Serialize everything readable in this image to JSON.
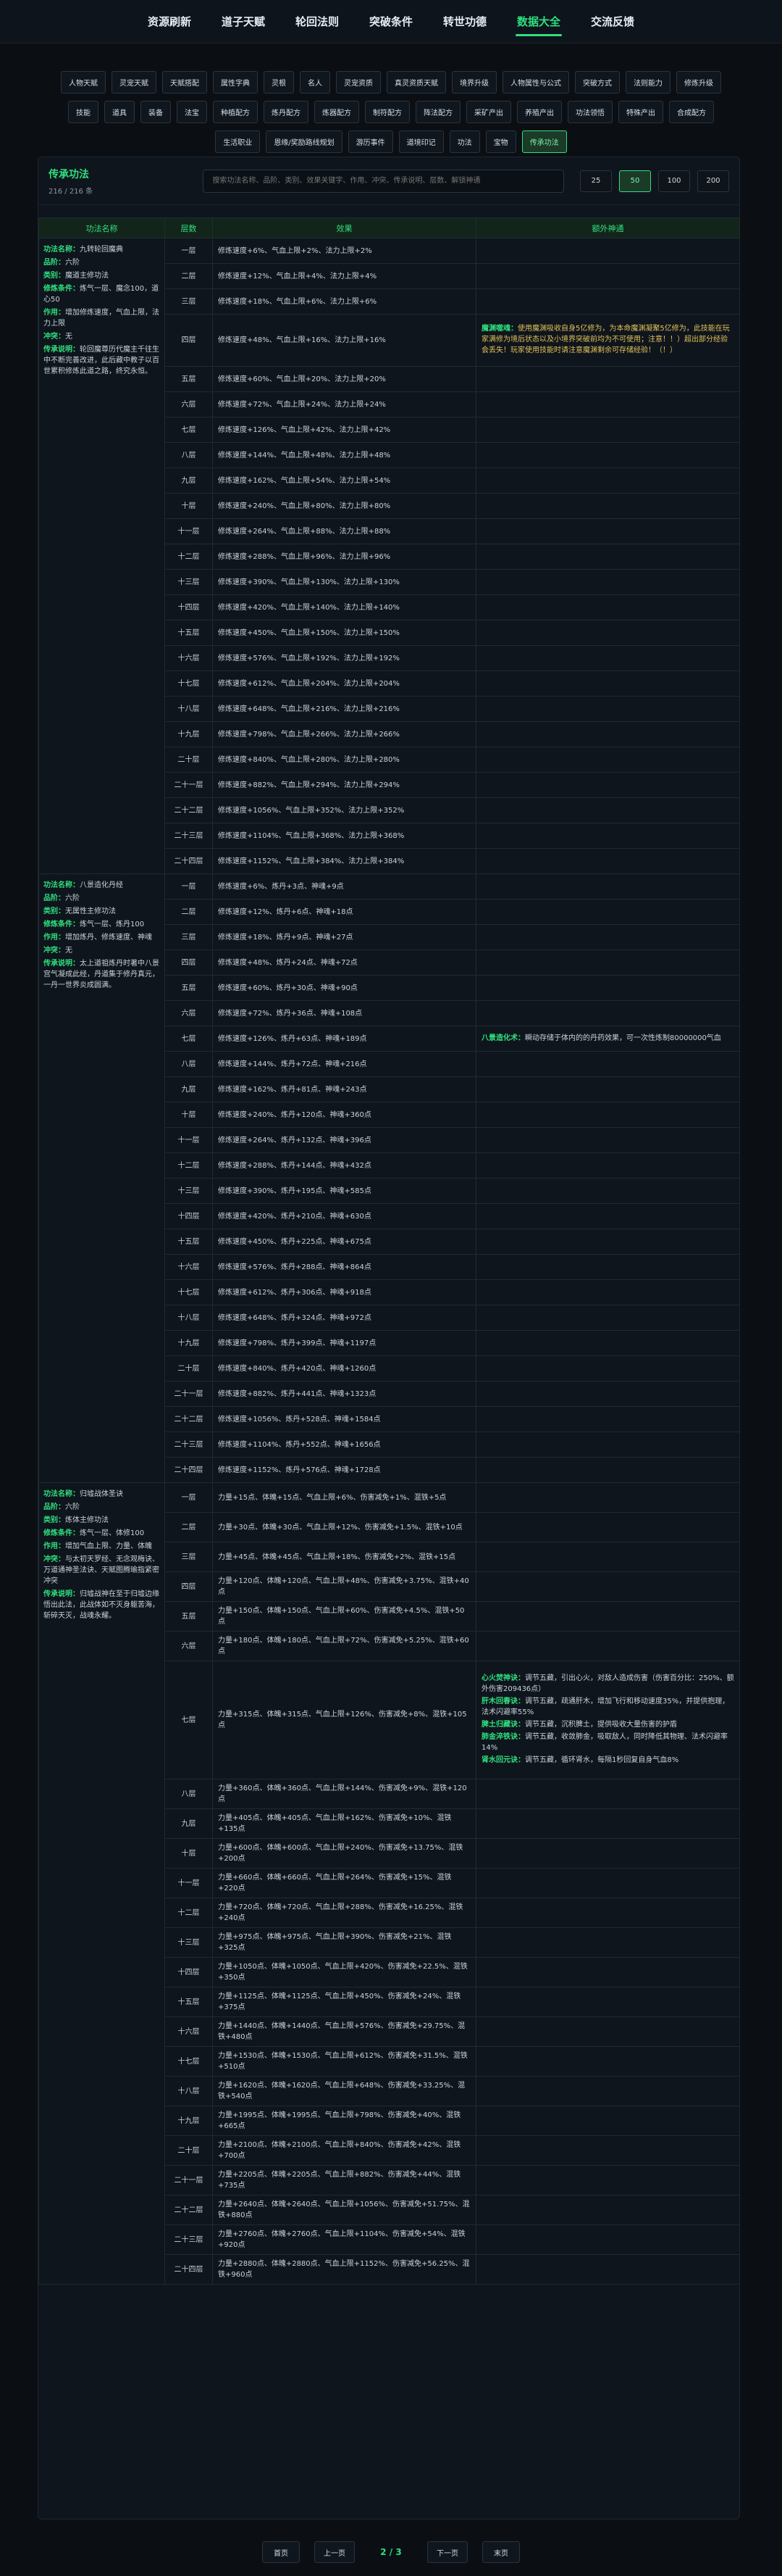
{
  "nav": [
    "资源刷新",
    "道子天赋",
    "轮回法则",
    "突破条件",
    "转世功德",
    "数据大全",
    "交流反馈"
  ],
  "nav_active": 5,
  "subtabs": [
    "人物天赋",
    "灵宠天赋",
    "天赋搭配",
    "属性字典",
    "灵根",
    "名人",
    "灵宠资质",
    "真灵资质天赋",
    "境界升级",
    "人物属性与公式",
    "突破方式",
    "法则能力",
    "修炼升级",
    "技能",
    "道具",
    "装备",
    "法宝",
    "种植配方",
    "炼丹配方",
    "炼器配方",
    "制符配方",
    "阵法配方",
    "采矿产出",
    "养殖产出",
    "功法领悟",
    "特殊产出",
    "合成配方",
    "生活职业",
    "恩缘/奖励路线规划",
    "游历事件",
    "道境印记",
    "功法",
    "宝物",
    "传承功法"
  ],
  "subtab_active": 33,
  "panel": {
    "title": "传承功法",
    "count": "216 / 216 条",
    "search_placeholder": "搜索功法名称、品阶、类别、效果关键字、作用、冲突、传承说明、层数、解锁神通",
    "page_sizes": [
      "25",
      "50",
      "100",
      "200"
    ],
    "page_size_active": 1
  },
  "table": {
    "headers": [
      "功法名称",
      "层数",
      "效果",
      "额外神通"
    ],
    "groups": [
      {
        "info": [
          {
            "k": "功法名称：",
            "v": "九转轮回魔典"
          },
          {
            "k": "品阶：",
            "v": "六阶"
          },
          {
            "k": "类别：",
            "v": "魔道主修功法"
          },
          {
            "k": "修炼条件：",
            "v": "炼气一层、魔念100，道心50"
          },
          {
            "k": "作用：",
            "v": "增加修炼速度，气血上限，法力上限"
          },
          {
            "k": "冲突：",
            "v": "无"
          },
          {
            "k": "传承说明：",
            "v": "轮回魔尊历代魔主千往生中不断完善改进，此后藏中教子以百世累积修炼此道之路，终究永恒。"
          }
        ],
        "rows": [
          {
            "layer": "一层",
            "effect": "修炼速度+6%、气血上限+2%、法力上限+2%"
          },
          {
            "layer": "二层",
            "effect": "修炼速度+12%、气血上限+4%、法力上限+4%"
          },
          {
            "layer": "三层",
            "effect": "修炼速度+18%、气血上限+6%、法力上限+6%"
          },
          {
            "layer": "四层",
            "effect": "修炼速度+48%、气血上限+16%、法力上限+16%",
            "bonus": [
              {
                "k": "魔渊噬魂：",
                "v": "使用魔渊吸收自身5亿修为，为本命魔渊凝聚5亿修为，此技能在玩家满修为境后状态以及小境界突破前均为不可使用；注意！！）超出部分经验会丢失！玩家使用技能时请注意魔渊剩余可存储经验！（！）",
                "c": "yl"
              }
            ]
          },
          {
            "layer": "五层",
            "effect": "修炼速度+60%、气血上限+20%、法力上限+20%"
          },
          {
            "layer": "六层",
            "effect": "修炼速度+72%、气血上限+24%、法力上限+24%"
          },
          {
            "layer": "七层",
            "effect": "修炼速度+126%、气血上限+42%、法力上限+42%"
          },
          {
            "layer": "八层",
            "effect": "修炼速度+144%、气血上限+48%、法力上限+48%"
          },
          {
            "layer": "九层",
            "effect": "修炼速度+162%、气血上限+54%、法力上限+54%"
          },
          {
            "layer": "十层",
            "effect": "修炼速度+240%、气血上限+80%、法力上限+80%"
          },
          {
            "layer": "十一层",
            "effect": "修炼速度+264%、气血上限+88%、法力上限+88%"
          },
          {
            "layer": "十二层",
            "effect": "修炼速度+288%、气血上限+96%、法力上限+96%"
          },
          {
            "layer": "十三层",
            "effect": "修炼速度+390%、气血上限+130%、法力上限+130%"
          },
          {
            "layer": "十四层",
            "effect": "修炼速度+420%、气血上限+140%、法力上限+140%"
          },
          {
            "layer": "十五层",
            "effect": "修炼速度+450%、气血上限+150%、法力上限+150%"
          },
          {
            "layer": "十六层",
            "effect": "修炼速度+576%、气血上限+192%、法力上限+192%"
          },
          {
            "layer": "十七层",
            "effect": "修炼速度+612%、气血上限+204%、法力上限+204%"
          },
          {
            "layer": "十八层",
            "effect": "修炼速度+648%、气血上限+216%、法力上限+216%"
          },
          {
            "layer": "十九层",
            "effect": "修炼速度+798%、气血上限+266%、法力上限+266%"
          },
          {
            "layer": "二十层",
            "effect": "修炼速度+840%、气血上限+280%、法力上限+280%"
          },
          {
            "layer": "二十一层",
            "effect": "修炼速度+882%、气血上限+294%、法力上限+294%"
          },
          {
            "layer": "二十二层",
            "effect": "修炼速度+1056%、气血上限+352%、法力上限+352%"
          },
          {
            "layer": "二十三层",
            "effect": "修炼速度+1104%、气血上限+368%、法力上限+368%"
          },
          {
            "layer": "二十四层",
            "effect": "修炼速度+1152%、气血上限+384%、法力上限+384%"
          }
        ]
      },
      {
        "info": [
          {
            "k": "功法名称：",
            "v": "八景造化丹经"
          },
          {
            "k": "品阶：",
            "v": "六阶"
          },
          {
            "k": "类别：",
            "v": "无属性主修功法"
          },
          {
            "k": "修炼条件：",
            "v": "炼气一层、炼丹100"
          },
          {
            "k": "作用：",
            "v": "增加炼丹、修炼速度、神魂"
          },
          {
            "k": "冲突：",
            "v": "无"
          },
          {
            "k": "传承说明：",
            "v": "太上道祖炼丹时著中八景宫气凝成此经，丹道集于修丹真元，一丹一世界炎成圆满。"
          }
        ],
        "rows": [
          {
            "layer": "一层",
            "effect": "修炼速度+6%、炼丹+3点、神魂+9点"
          },
          {
            "layer": "二层",
            "effect": "修炼速度+12%、炼丹+6点、神魂+18点"
          },
          {
            "layer": "三层",
            "effect": "修炼速度+18%、炼丹+9点、神魂+27点"
          },
          {
            "layer": "四层",
            "effect": "修炼速度+48%、炼丹+24点、神魂+72点"
          },
          {
            "layer": "五层",
            "effect": "修炼速度+60%、炼丹+30点、神魂+90点"
          },
          {
            "layer": "六层",
            "effect": "修炼速度+72%、炼丹+36点、神魂+108点"
          },
          {
            "layer": "七层",
            "effect": "修炼速度+126%、炼丹+63点、神魂+189点",
            "bonus": [
              {
                "k": "八景造化术：",
                "v": "瞬动存储于体内的的丹药效果，可一次性炼制80000000气血"
              }
            ]
          },
          {
            "layer": "八层",
            "effect": "修炼速度+144%、炼丹+72点、神魂+216点"
          },
          {
            "layer": "九层",
            "effect": "修炼速度+162%、炼丹+81点、神魂+243点"
          },
          {
            "layer": "十层",
            "effect": "修炼速度+240%、炼丹+120点、神魂+360点"
          },
          {
            "layer": "十一层",
            "effect": "修炼速度+264%、炼丹+132点、神魂+396点"
          },
          {
            "layer": "十二层",
            "effect": "修炼速度+288%、炼丹+144点、神魂+432点"
          },
          {
            "layer": "十三层",
            "effect": "修炼速度+390%、炼丹+195点、神魂+585点"
          },
          {
            "layer": "十四层",
            "effect": "修炼速度+420%、炼丹+210点、神魂+630点"
          },
          {
            "layer": "十五层",
            "effect": "修炼速度+450%、炼丹+225点、神魂+675点"
          },
          {
            "layer": "十六层",
            "effect": "修炼速度+576%、炼丹+288点、神魂+864点"
          },
          {
            "layer": "十七层",
            "effect": "修炼速度+612%、炼丹+306点、神魂+918点"
          },
          {
            "layer": "十八层",
            "effect": "修炼速度+648%、炼丹+324点、神魂+972点"
          },
          {
            "layer": "十九层",
            "effect": "修炼速度+798%、炼丹+399点、神魂+1197点"
          },
          {
            "layer": "二十层",
            "effect": "修炼速度+840%、炼丹+420点、神魂+1260点"
          },
          {
            "layer": "二十一层",
            "effect": "修炼速度+882%、炼丹+441点、神魂+1323点"
          },
          {
            "layer": "二十二层",
            "effect": "修炼速度+1056%、炼丹+528点、神魂+1584点"
          },
          {
            "layer": "二十三层",
            "effect": "修炼速度+1104%、炼丹+552点、神魂+1656点"
          },
          {
            "layer": "二十四层",
            "effect": "修炼速度+1152%、炼丹+576点、神魂+1728点"
          }
        ]
      },
      {
        "info": [
          {
            "k": "功法名称：",
            "v": "归墟战体圣诀"
          },
          {
            "k": "品阶：",
            "v": "六阶"
          },
          {
            "k": "类别：",
            "v": "炼体主修功法"
          },
          {
            "k": "修炼条件：",
            "v": "炼气一层、体修100"
          },
          {
            "k": "作用：",
            "v": "增加气血上限、力量、体魄"
          },
          {
            "k": "冲突：",
            "v": "与太初天罗经、无念观梅诀、万道通神圣法诀、天赋图腾瑜指紧密冲突"
          },
          {
            "k": "传承说明：",
            "v": "归墟战神在至于归墟边缘悟出此法，此战体如不灭身躯苦海，斩碎天灭，战魂永耀。"
          }
        ],
        "rows": [
          {
            "layer": "一层",
            "effect": "力量+15点、体魄+15点、气血上限+6%、伤害减免+1%、混铁+5点"
          },
          {
            "layer": "二层",
            "effect": "力量+30点、体魄+30点、气血上限+12%、伤害减免+1.5%、混铁+10点"
          },
          {
            "layer": "三层",
            "effect": "力量+45点、体魄+45点、气血上限+18%、伤害减免+2%、混铁+15点"
          },
          {
            "layer": "四层",
            "effect": "力量+120点、体魄+120点、气血上限+48%、伤害减免+3.75%、混铁+40点"
          },
          {
            "layer": "五层",
            "effect": "力量+150点、体魄+150点、气血上限+60%、伤害减免+4.5%、混铁+50点"
          },
          {
            "layer": "六层",
            "effect": "力量+180点、体魄+180点、气血上限+72%、伤害减免+5.25%、混铁+60点"
          },
          {
            "layer": "七层",
            "effect": "力量+315点、体魄+315点、气血上限+126%、伤害减免+8%、混铁+105点",
            "bonus": [
              {
                "k": "心火焚神诀：",
                "v": "调节五藏，引出心火，对敌人造成伤害（伤害百分比：250%、额外伤害209436点）"
              },
              {
                "k": "肝木回春诀：",
                "v": "调节五藏，疏通肝木，增加飞行和移动速度35%，并提供抱理，法术闪避率55%"
              },
              {
                "k": "脾土归藏诀：",
                "v": "调节五藏，沉积脾土，提供吸收大量伤害的护盾"
              },
              {
                "k": "肺金淬铁诀：",
                "v": "调节五藏，收敛肺金，吸取敌人，同时降低其物理、法术闪避率14%"
              },
              {
                "k": "肾水回元诀：",
                "v": "调节五藏，循环肾水，每隔1秒回复自身气血8%"
              }
            ]
          },
          {
            "layer": "八层",
            "effect": "力量+360点、体魄+360点、气血上限+144%、伤害减免+9%、混铁+120点"
          },
          {
            "layer": "九层",
            "effect": "力量+405点、体魄+405点、气血上限+162%、伤害减免+10%、混铁+135点"
          },
          {
            "layer": "十层",
            "effect": "力量+600点、体魄+600点、气血上限+240%、伤害减免+13.75%、混铁+200点"
          },
          {
            "layer": "十一层",
            "effect": "力量+660点、体魄+660点、气血上限+264%、伤害减免+15%、混铁+220点"
          },
          {
            "layer": "十二层",
            "effect": "力量+720点、体魄+720点、气血上限+288%、伤害减免+16.25%、混铁+240点"
          },
          {
            "layer": "十三层",
            "effect": "力量+975点、体魄+975点、气血上限+390%、伤害减免+21%、混铁+325点"
          },
          {
            "layer": "十四层",
            "effect": "力量+1050点、体魄+1050点、气血上限+420%、伤害减免+22.5%、混铁+350点"
          },
          {
            "layer": "十五层",
            "effect": "力量+1125点、体魄+1125点、气血上限+450%、伤害减免+24%、混铁+375点"
          },
          {
            "layer": "十六层",
            "effect": "力量+1440点、体魄+1440点、气血上限+576%、伤害减免+29.75%、混铁+480点"
          },
          {
            "layer": "十七层",
            "effect": "力量+1530点、体魄+1530点、气血上限+612%、伤害减免+31.5%、混铁+510点"
          },
          {
            "layer": "十八层",
            "effect": "力量+1620点、体魄+1620点、气血上限+648%、伤害减免+33.25%、混铁+540点"
          },
          {
            "layer": "十九层",
            "effect": "力量+1995点、体魄+1995点、气血上限+798%、伤害减免+40%、混铁+665点"
          },
          {
            "layer": "二十层",
            "effect": "力量+2100点、体魄+2100点、气血上限+840%、伤害减免+42%、混铁+700点"
          },
          {
            "layer": "二十一层",
            "effect": "力量+2205点、体魄+2205点、气血上限+882%、伤害减免+44%、混铁+735点"
          },
          {
            "layer": "二十二层",
            "effect": "力量+2640点、体魄+2640点、气血上限+1056%、伤害减免+51.75%、混铁+880点"
          },
          {
            "layer": "二十三层",
            "effect": "力量+2760点、体魄+2760点、气血上限+1104%、伤害减免+54%、混铁+920点"
          },
          {
            "layer": "二十四层",
            "effect": "力量+2880点、体魄+2880点、气血上限+1152%、伤害减免+56.25%、混铁+960点"
          }
        ]
      }
    ]
  },
  "pager": {
    "first": "首页",
    "prev": "上一页",
    "current": "2 / 3",
    "next": "下一页",
    "last": "末页"
  }
}
